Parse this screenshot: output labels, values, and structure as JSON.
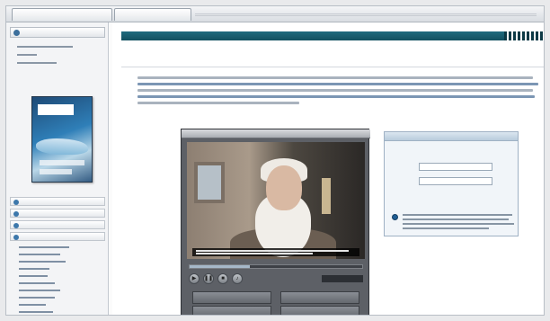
{
  "tabs": [
    {
      "label": ""
    },
    {
      "label": ""
    }
  ],
  "sidebar": {
    "header": "",
    "cover_title": "",
    "cover_caption": "",
    "links": [
      {
        "label": ""
      },
      {
        "label": ""
      },
      {
        "label": ""
      }
    ],
    "menu": [
      {
        "label": ""
      },
      {
        "label": ""
      },
      {
        "label": ""
      },
      {
        "label": ""
      },
      {
        "label": ""
      }
    ],
    "sub_items": [
      {
        "label": ""
      },
      {
        "label": ""
      },
      {
        "label": ""
      },
      {
        "label": ""
      },
      {
        "label": ""
      },
      {
        "label": ""
      },
      {
        "label": ""
      },
      {
        "label": ""
      },
      {
        "label": ""
      },
      {
        "label": ""
      }
    ]
  },
  "main": {
    "header": "",
    "section_title": "",
    "paragraph_lines": 5
  },
  "player": {
    "subtitle": "",
    "time": "",
    "progress": 0.35,
    "buttons": [
      {
        "label": ""
      },
      {
        "label": ""
      },
      {
        "label": ""
      },
      {
        "label": ""
      }
    ],
    "controls": [
      {
        "icon": "play-icon",
        "glyph": "▶"
      },
      {
        "icon": "pause-icon",
        "glyph": "❚❚"
      },
      {
        "icon": "stop-icon",
        "glyph": "■"
      },
      {
        "icon": "volume-icon",
        "glyph": "♪"
      }
    ]
  },
  "panel": {
    "header": "",
    "fields": [
      {
        "label": "",
        "value": ""
      },
      {
        "label": "",
        "value": ""
      }
    ],
    "check_text": ""
  },
  "colors": {
    "accent": "#12505f",
    "sidebar_bg": "#f3f4f6",
    "panel_bg": "#f1f5f9",
    "player_bg": "#5d6066"
  }
}
